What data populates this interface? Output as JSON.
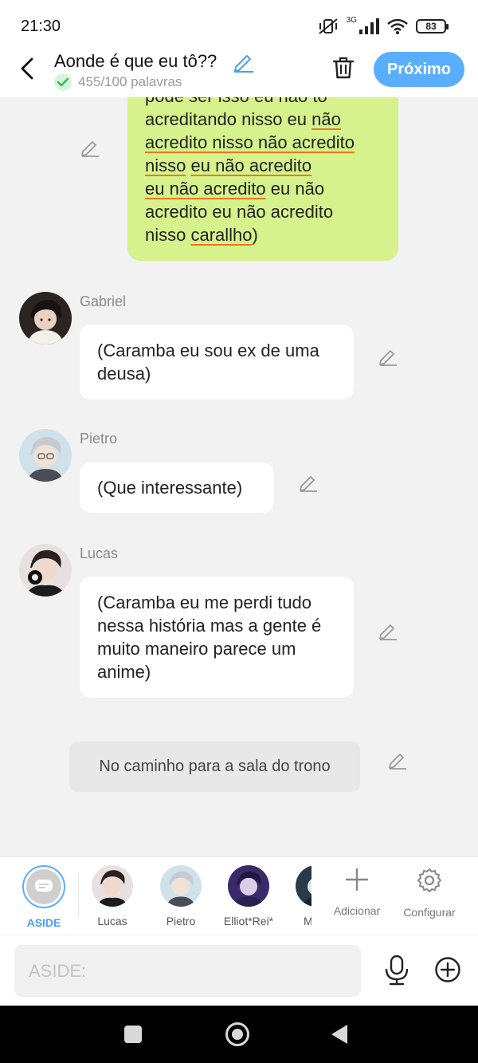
{
  "status_bar": {
    "time": "21:30",
    "network": "3G",
    "battery": "83"
  },
  "header": {
    "title": "Aonde é que eu tô??",
    "word_count": "455/100 palavras",
    "next_label": "Próximo"
  },
  "messages": {
    "narration_top": {
      "lines": [
        [
          {
            "t": "pode ser isso eu não tô",
            "u": false
          }
        ],
        [
          {
            "t": "acreditando nisso eu ",
            "u": false
          },
          {
            "t": "não",
            "u": true
          }
        ],
        [
          {
            "t": "acredito nisso não acredito",
            "u": true
          }
        ],
        [
          {
            "t": "nisso",
            "u": true
          },
          {
            "t": " ",
            "u": false
          },
          {
            "t": "eu não acredito",
            "u": true
          }
        ],
        [
          {
            "t": "eu não acredito",
            "u": true
          },
          {
            "t": " eu não",
            "u": false
          }
        ],
        [
          {
            "t": "acredito eu não acredito",
            "u": false
          }
        ],
        [
          {
            "t": "nisso ",
            "u": false
          },
          {
            "t": "carallho",
            "u": true
          },
          {
            "t": ")",
            "u": false
          }
        ]
      ]
    },
    "gabriel": {
      "name": "Gabriel",
      "text": "(Caramba eu sou ex de uma deusa)"
    },
    "pietro": {
      "name": "Pietro",
      "text": "(Que interessante)"
    },
    "lucas": {
      "name": "Lucas",
      "text": "(Caramba eu me perdi tudo nessa história mas a gente é muito maneiro parece um anime)"
    },
    "narration": {
      "text": "No caminho para a sala do trono"
    }
  },
  "characters": {
    "aside": "ASIDE",
    "lucas": "Lucas",
    "pietro": "Pietro",
    "elliot": "Elliot*Rei*",
    "m": "M",
    "add": "Adicionar",
    "config": "Configurar"
  },
  "input": {
    "placeholder": "ASIDE:"
  },
  "colors": {
    "accent": "#5aaeff",
    "narration_bubble": "#d6f28c",
    "underline": "#f0761c",
    "check": "#2ebd55"
  }
}
